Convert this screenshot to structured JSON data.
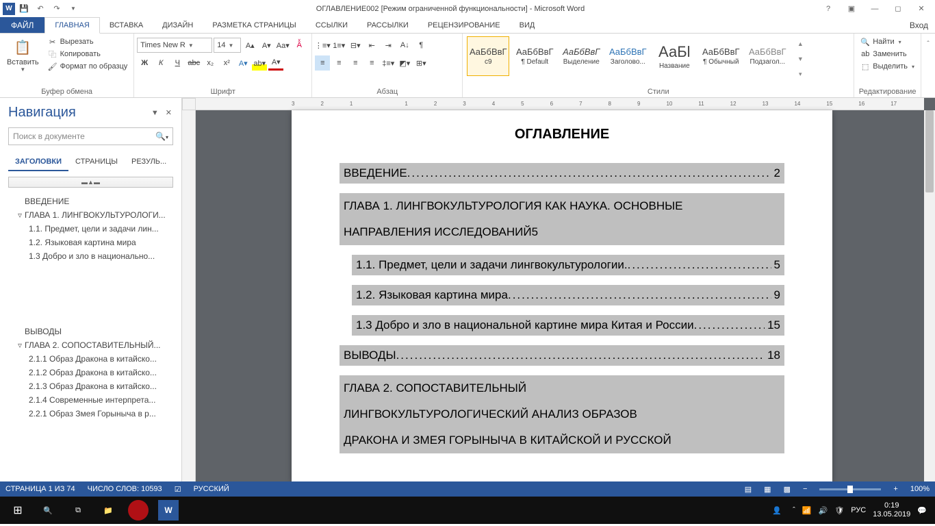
{
  "titlebar": {
    "title": "ОГЛАВЛЕНИЕ002 [Режим ограниченной функциональности] - Microsoft Word"
  },
  "tabs": {
    "file": "ФАЙЛ",
    "items": [
      "ГЛАВНАЯ",
      "ВСТАВКА",
      "ДИЗАЙН",
      "РАЗМЕТКА СТРАНИЦЫ",
      "ССЫЛКИ",
      "РАССЫЛКИ",
      "РЕЦЕНЗИРОВАНИЕ",
      "ВИД"
    ],
    "login": "Вход"
  },
  "ribbon": {
    "clipboard": {
      "paste": "Вставить",
      "cut": "Вырезать",
      "copy": "Копировать",
      "format": "Формат по образцу",
      "label": "Буфер обмена"
    },
    "font": {
      "name": "Times New R",
      "size": "14",
      "label": "Шрифт"
    },
    "paragraph": {
      "label": "Абзац"
    },
    "styles": {
      "label": "Стили",
      "items": [
        {
          "preview": "АаБбВвГ",
          "name": "с9"
        },
        {
          "preview": "АаБбВвГ",
          "name": "¶ Default"
        },
        {
          "preview": "АаБбВвГ",
          "name": "Выделение",
          "italic": true
        },
        {
          "preview": "АаБбВвГ",
          "name": "Заголово...",
          "color": "#2e74b5"
        },
        {
          "preview": "АаБl",
          "name": "Название",
          "big": true
        },
        {
          "preview": "АаБбВвГ",
          "name": "¶ Обычный"
        },
        {
          "preview": "АаБбВвГ",
          "name": "Подзагол...",
          "color": "#888"
        }
      ]
    },
    "editing": {
      "find": "Найти",
      "replace": "Заменить",
      "select": "Выделить",
      "label": "Редактирование"
    }
  },
  "nav": {
    "title": "Навигация",
    "search_placeholder": "Поиск в документе",
    "tabs": [
      "ЗАГОЛОВКИ",
      "СТРАНИЦЫ",
      "РЕЗУЛЬ..."
    ],
    "outline": [
      {
        "level": 1,
        "text": "ВВЕДЕНИЕ"
      },
      {
        "level": 1,
        "text": "ГЛАВА 1. ЛИНГВОКУЛЬТУРОЛОГИ...",
        "exp": true
      },
      {
        "level": 2,
        "text": "1.1. Предмет, цели и задачи лин..."
      },
      {
        "level": 2,
        "text": "1.2. Языковая картина мира"
      },
      {
        "level": 2,
        "text": "1.3 Добро и зло в национально..."
      },
      {
        "level": 0,
        "text": ""
      },
      {
        "level": 1,
        "text": "ВЫВОДЫ"
      },
      {
        "level": 1,
        "text": "ГЛАВА 2.  СОПОСТАВИТЕЛЬНЫЙ...",
        "exp": true
      },
      {
        "level": 2,
        "text": "2.1.1 Образ Дракона в китайско..."
      },
      {
        "level": 2,
        "text": "2.1.2  Образ Дракона в китайско..."
      },
      {
        "level": 2,
        "text": "2.1.3 Образ Дракона в китайско..."
      },
      {
        "level": 2,
        "text": "2.1.4 Современные интерпрета..."
      },
      {
        "level": 2,
        "text": "2.2.1  Образ Змея Горыныча в р..."
      }
    ]
  },
  "document": {
    "title": "ОГЛАВЛЕНИЕ",
    "toc": [
      {
        "type": "line",
        "level": 1,
        "text": "ВВЕДЕНИЕ",
        "page": "2"
      },
      {
        "type": "block",
        "level": 1,
        "lines": [
          "ГЛАВА 1. ЛИНГВОКУЛЬТУРОЛОГИЯ КАК НАУКА. ОСНОВНЫЕ",
          "НАПРАВЛЕНИЯ ИССЛЕДОВАНИЙ"
        ],
        "dots": true,
        "page": "5"
      },
      {
        "type": "line",
        "level": 2,
        "text": "1.1. Предмет, цели и задачи лингвокультурологии.",
        "page": "5"
      },
      {
        "type": "line",
        "level": 2,
        "text": "1.2. Языковая картина мира",
        "page": "9"
      },
      {
        "type": "line",
        "level": 2,
        "text": "1.3 Добро и зло в национальной картине мира Китая и России",
        "page": "15"
      },
      {
        "type": "line",
        "level": 1,
        "text": "ВЫВОДЫ",
        "page": "18"
      },
      {
        "type": "block",
        "level": 1,
        "lines": [
          "ГЛАВА 2.    СОПОСТАВИТЕЛЬНЫЙ",
          "ЛИНГВОКУЛЬТУРОЛОГИЧЕСКИЙ АНАЛИЗ ОБРАЗОВ",
          "ДРАКОНА И ЗМЕЯ ГОРЫНЫЧА В КИТАЙСКОЙ И РУССКОЙ"
        ]
      }
    ]
  },
  "ruler_marks": [
    "3",
    "2",
    "1",
    "",
    "1",
    "2",
    "3",
    "4",
    "5",
    "6",
    "7",
    "8",
    "9",
    "10",
    "11",
    "12",
    "13",
    "14",
    "15",
    "16",
    "17"
  ],
  "status": {
    "page": "СТРАНИЦА 1 ИЗ 74",
    "words": "ЧИСЛО СЛОВ: 10593",
    "lang": "РУССКИЙ",
    "zoom": "100%"
  },
  "taskbar": {
    "lang": "РУС",
    "time": "0:19",
    "date": "13.05.2019"
  }
}
